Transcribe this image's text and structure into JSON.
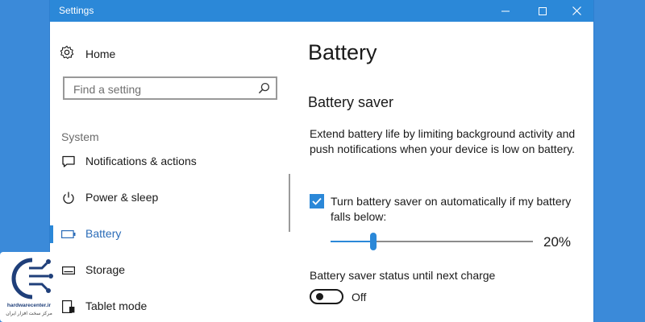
{
  "window": {
    "title": "Settings"
  },
  "sidebar": {
    "home_label": "Home",
    "search_placeholder": "Find a setting",
    "section_label": "System",
    "items": [
      {
        "label": "Notifications & actions",
        "icon": "notifications-icon"
      },
      {
        "label": "Power & sleep",
        "icon": "power-icon"
      },
      {
        "label": "Battery",
        "icon": "battery-icon",
        "active": true
      },
      {
        "label": "Storage",
        "icon": "storage-icon"
      },
      {
        "label": "Tablet mode",
        "icon": "tablet-mode-icon"
      }
    ]
  },
  "content": {
    "title": "Battery",
    "subtitle": "Battery saver",
    "description": "Extend battery life by limiting background activity and push notifications when your device is low on battery.",
    "auto_checkbox": {
      "label": "Turn battery saver on automatically if my battery falls below:",
      "checked": true
    },
    "threshold": {
      "value": 20,
      "value_text": "20%"
    },
    "status": {
      "label": "Battery saver status until next charge",
      "toggle_text": "Off",
      "on": false
    }
  },
  "watermark": {
    "brand": "hardwarecenter.ir",
    "tagline": "مرکز سخت افزار ایران"
  },
  "colors": {
    "accent": "#2b88d8",
    "desktop": "#3b8ad9"
  }
}
